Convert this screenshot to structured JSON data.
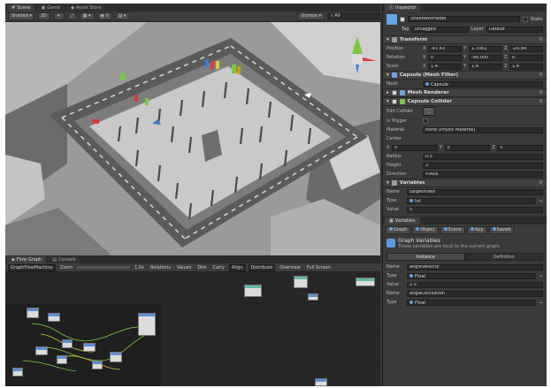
{
  "scene_tabs": [
    {
      "label": "Scene",
      "icon": "scene-icon"
    },
    {
      "label": "Game",
      "icon": "game-icon"
    },
    {
      "label": "Asset Store",
      "icon": "asset-store-icon"
    }
  ],
  "scene_toolbar": {
    "shading_mode": "Shaded",
    "mode_2d": "2D",
    "gizmos": "Gizmos",
    "search_placeholder": "All"
  },
  "graph_tabs": [
    {
      "label": "Flow Graph",
      "icon": "flow-graph-icon"
    },
    {
      "label": "Console",
      "icon": "console-icon"
    }
  ],
  "graph_toolbar": {
    "breadcrumb": "GraphFlowMachine",
    "zoom_label": "Zoom",
    "zoom_value": "1.0x",
    "relations": "Relations",
    "values": "Values",
    "dim": "Dim",
    "carry": "Carry",
    "align": "Align",
    "distribute": "Distribute",
    "overview": "Overview",
    "full_screen": "Full Screen"
  },
  "inspector": {
    "tab": "Inspector",
    "object_name": "ShadowRtrNode",
    "static_label": "Static",
    "tag_label": "Tag",
    "tag_value": "Untagged",
    "layer_label": "Layer",
    "layer_value": "Default",
    "transform": {
      "title": "Transform",
      "position_label": "Position",
      "position": {
        "x": "-47.43",
        "y": "1.7061",
        "z": "-20.84"
      },
      "rotation_label": "Rotation",
      "rotation": {
        "x": "0",
        "y": "-90.000",
        "z": "0"
      },
      "scale_label": "Scale",
      "scale": {
        "x": "1.4",
        "y": "1.4",
        "z": "1.4"
      }
    },
    "mesh_filter": {
      "title": "Capsule (Mesh Filter)",
      "mesh_label": "Mesh",
      "mesh_value": "Capsule"
    },
    "mesh_renderer": {
      "title": "Mesh Renderer"
    },
    "capsule_collider": {
      "title": "Capsule Collider",
      "edit_collider_label": "Edit Collider",
      "is_trigger_label": "Is Trigger",
      "material_label": "Material",
      "material_value": "None (Physic Material)",
      "center_label": "Center",
      "center": {
        "x": "0",
        "y": "0",
        "z": "0"
      },
      "radius_label": "Radius",
      "radius_value": "0.5",
      "height_label": "Height",
      "height_value": "2",
      "direction_label": "Direction",
      "direction_value": "Y-Axis"
    },
    "variables": {
      "title": "Variables",
      "name_label": "Name",
      "name_value": "targetIndex",
      "type_label": "Type",
      "type_value": "Int",
      "value_label": "Value",
      "value_value": "5"
    }
  },
  "variables_panel": {
    "tab": "Variables",
    "scope_tabs": [
      "Graph",
      "Object",
      "Scene",
      "App",
      "Saved"
    ],
    "heading": "Graph Variables",
    "description": "These variables are local to the current graph.",
    "sub_tabs": [
      "Instance",
      "Definition"
    ],
    "entries": [
      {
        "name_label": "Name",
        "name": "angleVelocity",
        "type_label": "Type",
        "type": "Float",
        "value_label": "Value",
        "value": "2.5"
      },
      {
        "name_label": "Name",
        "name": "angleOscillation",
        "type_label": "Type",
        "type": "Float"
      }
    ]
  },
  "colors": {
    "editor_bg": "#383838",
    "graph_bg": "#262626",
    "accent_blue": "#5f9be0",
    "viewport_bg": "#8e8e8e"
  }
}
